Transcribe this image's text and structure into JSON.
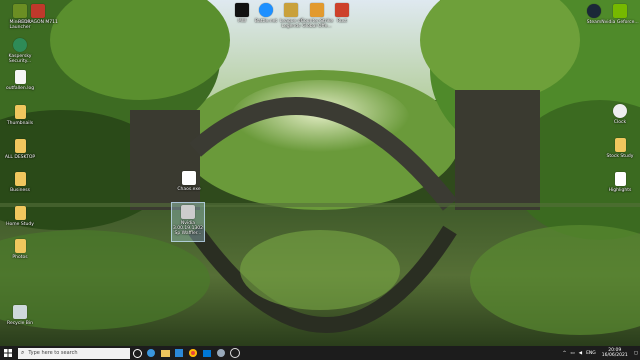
{
  "desktop": {
    "left_icons": [
      {
        "label": "Minecraft Launcher",
        "icon": "minecraft-icon",
        "color": "#6b8e23"
      },
      {
        "label": "REDRAGON M711",
        "icon": "redragon-icon",
        "color": "#c0392b"
      },
      {
        "label": "Kaspersky Security...",
        "icon": "kaspersky-icon",
        "color": "#2e8b57"
      },
      {
        "label": "outfallen.log",
        "icon": "text-file-icon",
        "color": "#f5f5f5"
      },
      {
        "label": "Thumbnails",
        "icon": "folder-icon",
        "color": "#f0c75e"
      },
      {
        "label": "ALL DESKTOP",
        "icon": "folder-icon",
        "color": "#f0c75e"
      },
      {
        "label": "Business",
        "icon": "folder-icon",
        "color": "#f0c75e"
      },
      {
        "label": "Home Study",
        "icon": "folder-icon",
        "color": "#f0c75e"
      },
      {
        "label": "Photos",
        "icon": "folder-icon",
        "color": "#f0c75e"
      },
      {
        "label": "Recycle Bin",
        "icon": "recycle-bin-icon",
        "color": "#cfd8dc"
      }
    ],
    "top_icons": [
      {
        "label": "MW",
        "icon": "mw-icon",
        "color": "#111111"
      },
      {
        "label": "Battle.net",
        "icon": "battlenet-icon",
        "color": "#1e90ff"
      },
      {
        "label": "League of Legends",
        "icon": "league-icon",
        "color": "#c9a13b"
      },
      {
        "label": "Counter-Strike Global Offe...",
        "icon": "csgo-icon",
        "color": "#e29a2e"
      },
      {
        "label": "Rust",
        "icon": "rust-icon",
        "color": "#cd412b"
      }
    ],
    "right_icons": [
      {
        "label": "Steam",
        "icon": "steam-icon",
        "color": "#1b2838"
      },
      {
        "label": "Nvidia Geforce...",
        "icon": "nvidia-icon",
        "color": "#76b900"
      },
      {
        "label": "Clock",
        "icon": "clock-icon",
        "color": "#eeeeee"
      },
      {
        "label": "Stock Study",
        "icon": "document-icon",
        "color": "#f0c75e"
      },
      {
        "label": "Highlights",
        "icon": "document-icon",
        "color": "#ffffff"
      }
    ],
    "middle_icons": [
      {
        "label": "Chaos.exe",
        "icon": "chaos-icon",
        "color": "#ffffff",
        "selected": false
      },
      {
        "label": "Nvidia 3.00.19.1302 Sp Waffler... ",
        "icon": "installer-icon",
        "color": "#cccccc",
        "selected": true
      }
    ]
  },
  "taskbar": {
    "search_placeholder": "Type here to search",
    "pinned": [
      {
        "icon": "task-view-icon",
        "color": "#ffffff"
      },
      {
        "icon": "edge-icon",
        "color": "#3a96dd"
      },
      {
        "icon": "file-explorer-icon",
        "color": "#f0c75e"
      },
      {
        "icon": "store-icon",
        "color": "#2b88d8"
      },
      {
        "icon": "chrome-icon",
        "color": "#e8453c"
      },
      {
        "icon": "photos-icon",
        "color": "#0078d7"
      },
      {
        "icon": "steam-taskbar-icon",
        "color": "#9ab"
      },
      {
        "icon": "obs-icon",
        "color": "#dddddd"
      }
    ],
    "tray": {
      "language": "ENG",
      "time": "20:09",
      "date": "16/06/2021"
    }
  },
  "colors": {
    "taskbar_bg": "#1c1c1c",
    "search_bg": "#f2f2f2"
  }
}
